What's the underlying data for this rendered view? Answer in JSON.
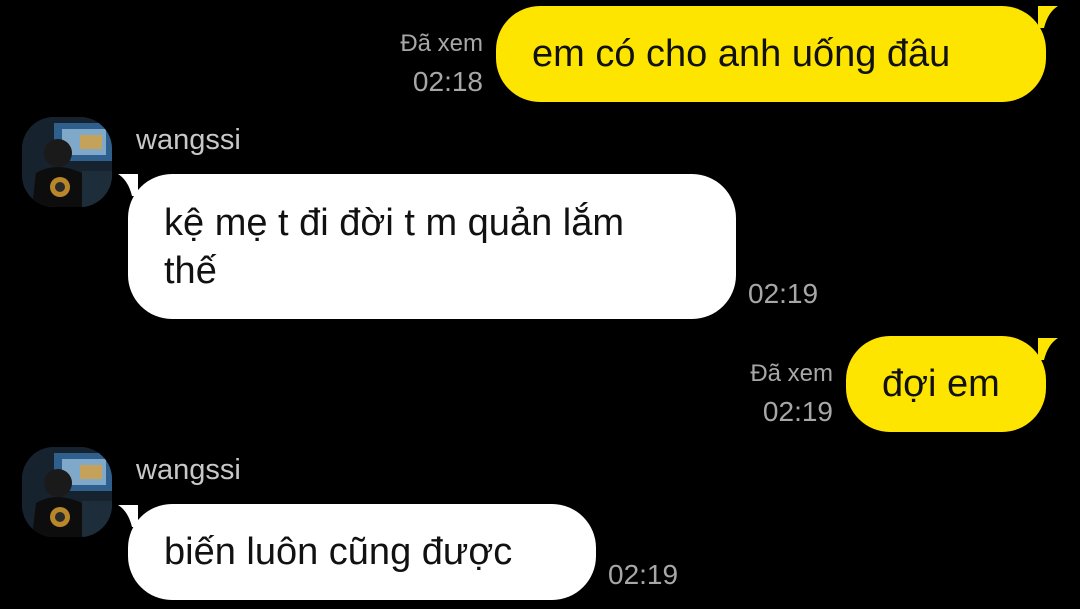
{
  "chat": {
    "messages": [
      {
        "direction": "out",
        "text": "em có cho anh uống đâu",
        "seen": "Đã xem",
        "time": "02:18"
      },
      {
        "direction": "in",
        "sender": "wangssi",
        "text_lines": [
          "kệ mẹ t đi đời t m quản lắm",
          "thế"
        ],
        "time": "02:19"
      },
      {
        "direction": "out",
        "text": "đợi em",
        "seen": "Đã xem",
        "time": "02:19"
      },
      {
        "direction": "in",
        "sender": "wangssi",
        "text": "biến luôn cũng được",
        "time": "02:19"
      }
    ]
  },
  "colors": {
    "background": "#000000",
    "outgoing_bubble": "#FEE500",
    "incoming_bubble": "#FFFFFF",
    "meta_text": "#A7A7A7"
  }
}
